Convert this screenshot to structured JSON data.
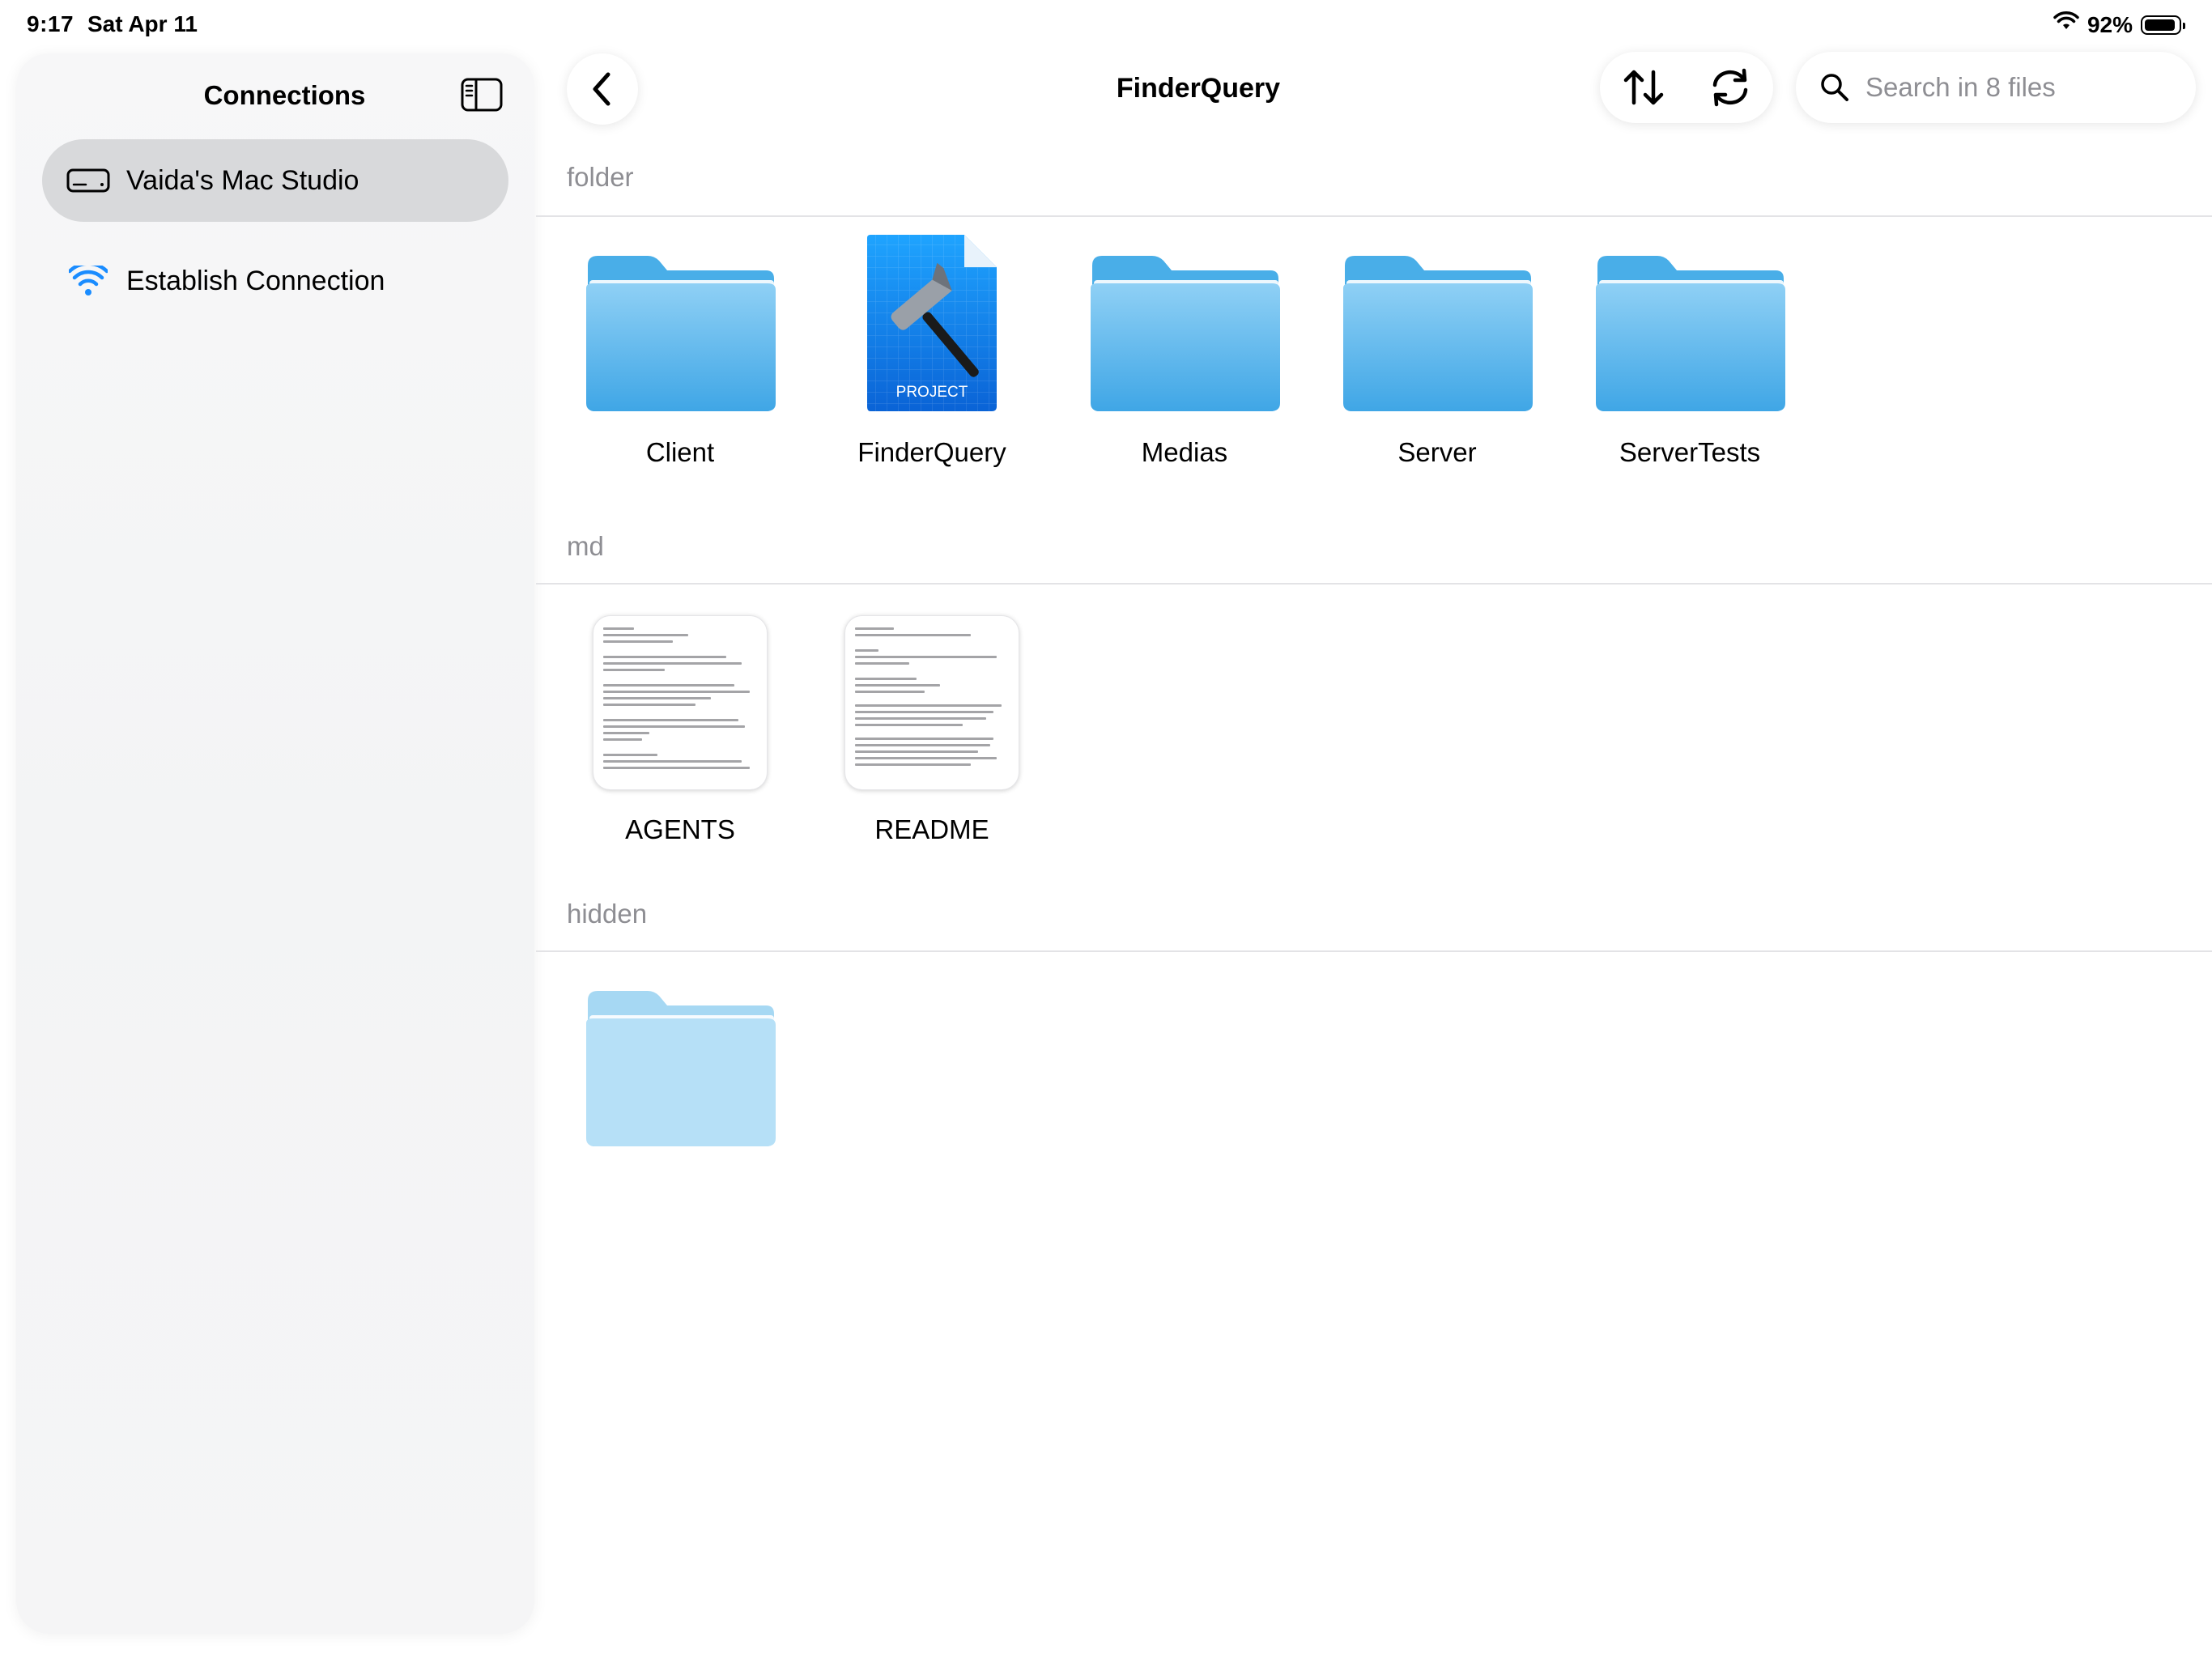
{
  "status_bar": {
    "time": "9:17",
    "date": "Sat Apr 11",
    "battery_percent": "92%",
    "battery_level": 0.92
  },
  "sidebar": {
    "title": "Connections",
    "toggle_icon": "sidebar-icon",
    "items": [
      {
        "label": "Vaida's Mac Studio",
        "icon": "mac-studio-icon",
        "selected": true
      },
      {
        "label": "Establish Connection",
        "icon": "wifi-icon",
        "selected": false
      }
    ]
  },
  "toolbar": {
    "title": "FinderQuery",
    "back_icon": "chevron-left-icon",
    "sort_icon": "sort-arrows-icon",
    "refresh_icon": "refresh-icon",
    "search_placeholder": "Search in 8 files"
  },
  "sections": [
    {
      "header": "folder",
      "items": [
        {
          "label": "Client",
          "kind": "folder"
        },
        {
          "label": "FinderQuery",
          "kind": "xcode-project",
          "badge": "PROJECT"
        },
        {
          "label": "Medias",
          "kind": "folder"
        },
        {
          "label": "Server",
          "kind": "folder"
        },
        {
          "label": "ServerTests",
          "kind": "folder"
        }
      ]
    },
    {
      "header": "md",
      "items": [
        {
          "label": "AGENTS",
          "kind": "markdown"
        },
        {
          "label": "README",
          "kind": "markdown"
        }
      ]
    },
    {
      "header": "hidden",
      "items": [
        {
          "label": "",
          "kind": "hidden-folder"
        }
      ]
    }
  ],
  "colors": {
    "accent": "#1a8cff",
    "folder_top": "#8fd0f5",
    "folder_bottom": "#3fa6e6",
    "hidden_folder": "#b6e0f7",
    "selected_row": "#d8d9db",
    "section_header": "#8e8e93"
  }
}
